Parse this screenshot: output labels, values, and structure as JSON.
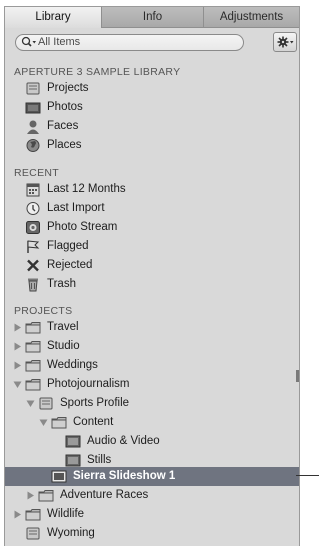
{
  "tabs": [
    "Library",
    "Info",
    "Adjustments"
  ],
  "search": {
    "placeholder": "All Items"
  },
  "sections": {
    "sample": {
      "header": "APERTURE 3 SAMPLE LIBRARY",
      "items": [
        "Projects",
        "Photos",
        "Faces",
        "Places"
      ]
    },
    "recent": {
      "header": "RECENT",
      "items": [
        "Last 12 Months",
        "Last Import",
        "Photo Stream",
        "Flagged",
        "Rejected",
        "Trash"
      ]
    },
    "projects": {
      "header": "PROJECTS",
      "items": [
        "Travel",
        "Studio",
        "Weddings",
        "Photojournalism",
        "Sports Profile",
        "Content",
        "Audio & Video",
        "Stills",
        "Sierra Slideshow 1",
        "Adventure Races",
        "Wildlife",
        "Wyoming"
      ]
    }
  },
  "selected_item": "Sierra Slideshow 1"
}
